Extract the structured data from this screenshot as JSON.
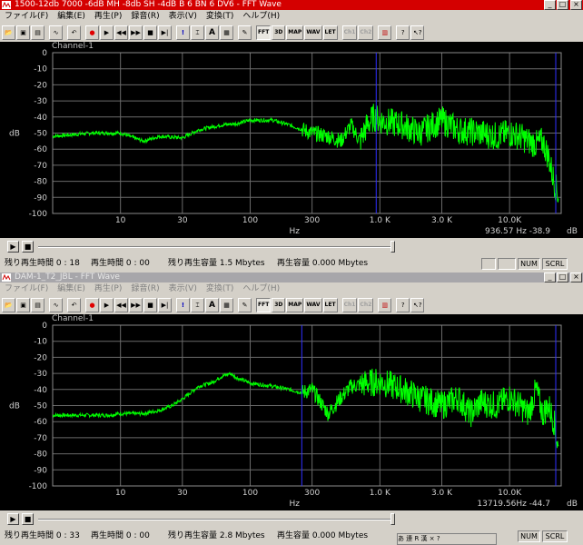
{
  "windows": [
    {
      "title": "1500-12db 7000 -6dB MH -8db SH -4dB B 6 BN 6 DV6 - FFT Wave",
      "active": true,
      "menu": [
        "ファイル(F)",
        "編集(E)",
        "再生(P)",
        "録音(R)",
        "表示(V)",
        "変換(T)",
        "ヘルプ(H)"
      ],
      "toolbar": [
        "FFT",
        "3D",
        "MAP",
        "WAV",
        "LET",
        "Ch1",
        "Ch2"
      ],
      "channel_label": "Channel-1",
      "readout": "936.57  Hz -38.9",
      "status": {
        "remain_time": "残り再生時間 0 : 18",
        "play_time": "再生時間 0 : 00",
        "remain_capacity": "残り再生容量 1.5 Mbytes",
        "play_capacity": "再生容量 0.000 Mbytes",
        "num": "NUM",
        "scrl": "SCRL"
      },
      "chart_data": {
        "type": "line",
        "xlabel": "Hz",
        "ylabel": "dB",
        "x_scale": "log",
        "x_ticks": [
          "10",
          "30",
          "100",
          "300",
          "1.0 K",
          "3.0 K",
          "10.0K"
        ],
        "y_ticks": [
          "0",
          "-10",
          "-20",
          "-30",
          "-40",
          "-50",
          "-60",
          "-70",
          "-80",
          "-90",
          "-100"
        ],
        "ylim": [
          -100,
          0
        ],
        "xlim": [
          3,
          25000
        ],
        "cursor_hz": 936.57,
        "cursor_db": -38.9,
        "grid": true,
        "color": "#00ff00",
        "series": [
          {
            "x": [
              3,
              6,
              10,
              15,
              20,
              30,
              40,
              60,
              80,
              100,
              150,
              200,
              300,
              400,
              500,
              600,
              700,
              800,
              900,
              1000,
              1500,
              2000,
              3000,
              4000,
              6000,
              8000,
              10000,
              12000,
              14000,
              16000,
              18000,
              20000,
              22000,
              24000
            ],
            "values": [
              -52,
              -50,
              -50,
              -55,
              -52,
              -53,
              -48,
              -45,
              -44,
              -42,
              -42,
              -45,
              -50,
              -52,
              -55,
              -45,
              -55,
              -45,
              -40,
              -42,
              -45,
              -50,
              -42,
              -48,
              -50,
              -52,
              -50,
              -52,
              -55,
              -57,
              -55,
              -65,
              -80,
              -90
            ]
          }
        ]
      }
    },
    {
      "title": "DAM-1_T2_JBL - FFT Wave",
      "active": false,
      "menu": [
        "ファイル(F)",
        "編集(E)",
        "再生(P)",
        "録音(R)",
        "表示(V)",
        "変換(T)",
        "ヘルプ(H)"
      ],
      "toolbar": [
        "FFT",
        "3D",
        "MAP",
        "WAV",
        "LET",
        "Ch1",
        "Ch2"
      ],
      "channel_label": "Channel-1",
      "readout": "13719.56Hz -44.7",
      "status": {
        "remain_time": "残り再生時間 0 : 33",
        "play_time": "再生時間 0 : 00",
        "remain_capacity": "残り再生容量 2.8 Mbytes",
        "play_capacity": "再生容量 0.000 Mbytes",
        "num": "NUM",
        "scrl": "SCRL"
      },
      "ime_bar": "あ 連 R 漢 × ?",
      "chart_data": {
        "type": "line",
        "xlabel": "Hz",
        "ylabel": "dB",
        "x_scale": "log",
        "x_ticks": [
          "10",
          "30",
          "100",
          "300",
          "1.0 K",
          "3.0 K",
          "10.0K"
        ],
        "y_ticks": [
          "0",
          "-10",
          "-20",
          "-30",
          "-40",
          "-50",
          "-60",
          "-70",
          "-80",
          "-90",
          "-100"
        ],
        "ylim": [
          -100,
          0
        ],
        "xlim": [
          3,
          25000
        ],
        "cursor_hz": 250,
        "cursor_db": -44.7,
        "grid": true,
        "color": "#00ff00",
        "series": [
          {
            "x": [
              3,
              5,
              8,
              10,
              15,
              20,
              25,
              30,
              40,
              50,
              60,
              70,
              80,
              100,
              150,
              200,
              250,
              300,
              400,
              500,
              600,
              800,
              1000,
              1500,
              2000,
              3000,
              4000,
              5000,
              6000,
              8000,
              10000,
              12000,
              14000,
              16000,
              18000,
              20000,
              22000,
              24000
            ],
            "values": [
              -56,
              -56,
              -56,
              -55,
              -55,
              -53,
              -50,
              -46,
              -38,
              -36,
              -32,
              -30,
              -33,
              -36,
              -38,
              -40,
              -42,
              -40,
              -55,
              -45,
              -38,
              -36,
              -35,
              -40,
              -45,
              -50,
              -45,
              -55,
              -48,
              -50,
              -45,
              -50,
              -55,
              -40,
              -55,
              -50,
              -60,
              -80
            ]
          }
        ]
      }
    }
  ]
}
